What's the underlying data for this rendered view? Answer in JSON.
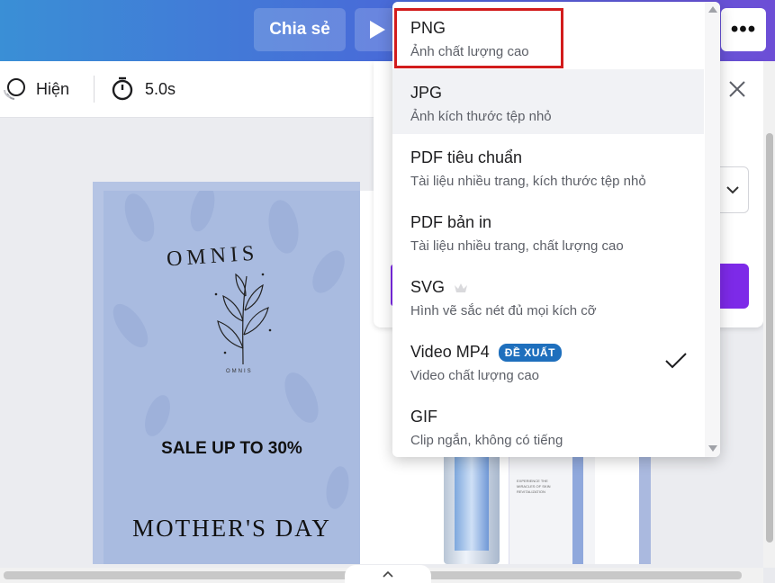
{
  "header": {
    "share_label": "Chia sẻ",
    "more_label": "•••"
  },
  "toolbar": {
    "appear_label": "Hiện",
    "duration_label": "5.0s"
  },
  "design": {
    "brand": "OMNIS",
    "brand_small": "OMNIS",
    "sale": "SALE UP TO 30%",
    "headline": "MOTHER'S DAY",
    "product_text": "EXPERIENCE THE MIRACLES OF SKIN REVITALIZATION"
  },
  "dropdown": {
    "options": [
      {
        "title": "PNG",
        "desc": "Ảnh chất lượng cao",
        "highlighted": true
      },
      {
        "title": "JPG",
        "desc": "Ảnh kích thước tệp nhỏ",
        "hover": true
      },
      {
        "title": "PDF tiêu chuẩn",
        "desc": "Tài liệu nhiều trang, kích thước tệp nhỏ"
      },
      {
        "title": "PDF bản in",
        "desc": "Tài liệu nhiều trang, chất lượng cao"
      },
      {
        "title": "SVG",
        "desc": "Hình vẽ sắc nét đủ mọi kích cỡ",
        "icon": "crown-icon"
      },
      {
        "title": "Video MP4",
        "desc": "Video chất lượng cao",
        "badge": "ĐỀ XUẤT",
        "selected": true
      },
      {
        "title": "GIF",
        "desc": "Clip ngắn, không có tiếng"
      }
    ]
  },
  "colors": {
    "accent": "#7d2ae8",
    "highlight": "#d21c1c",
    "badge": "#1e6fbd"
  }
}
